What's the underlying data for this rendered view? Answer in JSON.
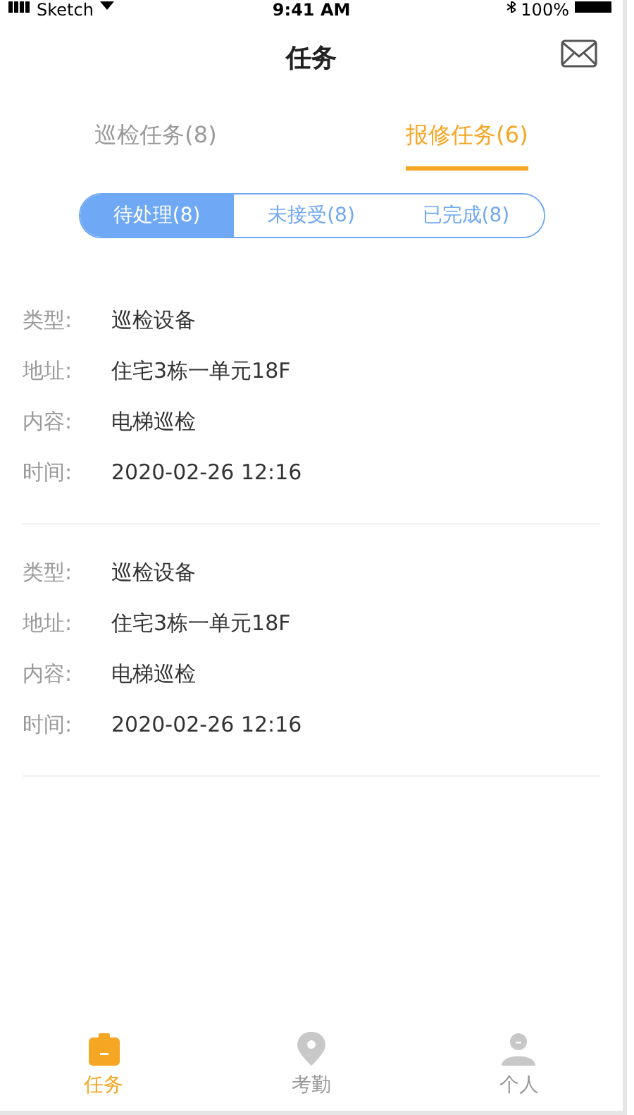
{
  "status_bar": {
    "carrier": "Sketch",
    "time": "9:41 AM",
    "battery": "100%"
  },
  "header": {
    "title": "任务"
  },
  "tabs": [
    {
      "label": "巡检任务(8)",
      "selected": false
    },
    {
      "label": "报修任务(6)",
      "selected": true
    }
  ],
  "filters": [
    {
      "label": "待处理(8)",
      "selected": true
    },
    {
      "label": "未接受(8)",
      "selected": false
    },
    {
      "label": "已完成(8)",
      "selected": false
    }
  ],
  "tasks": [
    {
      "fields": [
        {
          "label": "类型:",
          "value": "巡检设备"
        },
        {
          "label": "地址:",
          "value": "住宅3栋一单元18F"
        },
        {
          "label": "内容:",
          "value": "电梯巡检"
        },
        {
          "label": "时间:",
          "value": "2020-02-26 12:16"
        }
      ]
    },
    {
      "fields": [
        {
          "label": "类型:",
          "value": "巡检设备"
        },
        {
          "label": "地址:",
          "value": "住宅3栋一单元18F"
        },
        {
          "label": "内容:",
          "value": "电梯巡检"
        },
        {
          "label": "时间:",
          "value": "2020-02-26 12:16"
        }
      ]
    }
  ],
  "bottom_nav": [
    {
      "kind": "task",
      "label": "任务",
      "selected": true
    },
    {
      "kind": "location",
      "label": "考勤",
      "selected": false
    },
    {
      "kind": "person",
      "label": "个人",
      "selected": false
    }
  ]
}
